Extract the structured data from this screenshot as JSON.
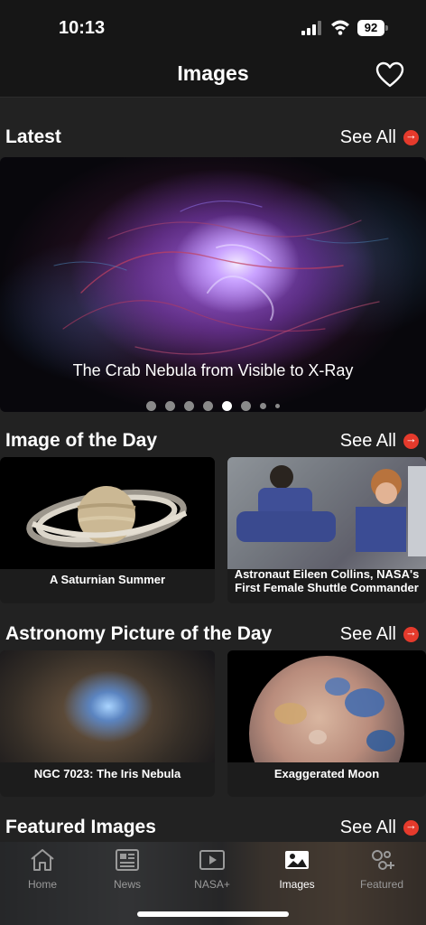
{
  "status_bar": {
    "time": "10:13",
    "battery": "92",
    "signal_icon": "signal-bars-icon",
    "wifi_icon": "wifi-icon"
  },
  "nav": {
    "title": "Images",
    "favorites_icon": "heart-icon"
  },
  "sections": {
    "latest": {
      "title": "Latest",
      "see_all": "See All",
      "hero_caption": "The Crab Nebula from Visible to X-Ray",
      "carousel": {
        "count": 8,
        "active_index": 4
      }
    },
    "image_of_day": {
      "title": "Image of the Day",
      "see_all": "See All",
      "cards": [
        {
          "title": "A Saturnian Summer"
        },
        {
          "title_line1": "Astronaut Eileen Collins, NASA's",
          "title_line2": "First Female Shuttle Commander"
        }
      ]
    },
    "apod": {
      "title": "Astronomy Picture of the Day",
      "see_all": "See All",
      "cards": [
        {
          "title": "NGC 7023: The Iris Nebula"
        },
        {
          "title": "Exaggerated Moon"
        }
      ]
    },
    "featured": {
      "title": "Featured Images",
      "see_all": "See All"
    }
  },
  "tabs": [
    {
      "label": "Home",
      "icon": "house-icon"
    },
    {
      "label": "News",
      "icon": "newspaper-icon"
    },
    {
      "label": "NASA+",
      "icon": "play-icon"
    },
    {
      "label": "Images",
      "icon": "image-icon",
      "active": true
    },
    {
      "label": "Featured",
      "icon": "planets-icon"
    }
  ],
  "colors": {
    "accent": "#e53a2c",
    "background": "#222222",
    "bar": "#161616"
  }
}
